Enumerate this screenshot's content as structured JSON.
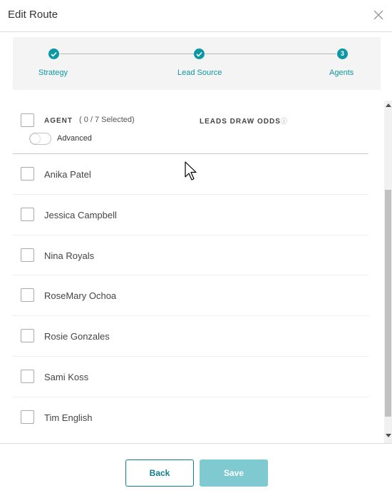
{
  "dialog": {
    "title": "Edit Route",
    "close_icon": "close-icon"
  },
  "stepper": {
    "accent_color": "#0b97a3",
    "steps": [
      {
        "label": "Strategy",
        "state": "completed",
        "icon": "check-icon"
      },
      {
        "label": "Lead Source",
        "state": "completed",
        "icon": "check-icon"
      },
      {
        "label": "Agents",
        "state": "current",
        "number": "3"
      }
    ]
  },
  "agents_table": {
    "select_all_checked": false,
    "agent_header": "AGENT",
    "selected_count": "( 0 / 7 Selected)",
    "odds_header": "LEADS DRAW ODDS",
    "odds_info_icon": "info-icon",
    "advanced_toggle": {
      "label": "Advanced",
      "on": false
    },
    "rows": [
      {
        "name": "Anika Patel",
        "checked": false
      },
      {
        "name": "Jessica Campbell",
        "checked": false
      },
      {
        "name": "Nina Royals",
        "checked": false
      },
      {
        "name": "RoseMary Ochoa",
        "checked": false
      },
      {
        "name": "Rosie Gonzales",
        "checked": false
      },
      {
        "name": "Sami Koss",
        "checked": false
      },
      {
        "name": "Tim English",
        "checked": false
      }
    ]
  },
  "footer": {
    "back_label": "Back",
    "save_label": "Save",
    "save_enabled": false
  }
}
